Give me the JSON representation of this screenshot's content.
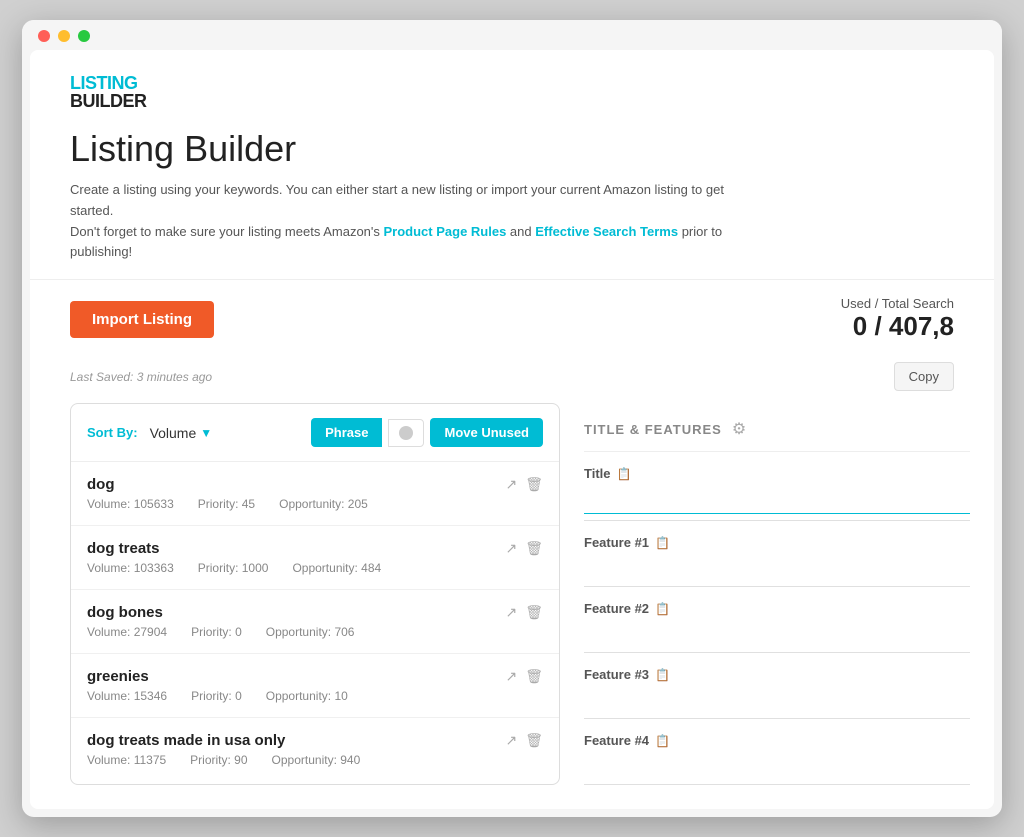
{
  "window": {
    "chrome_dots": [
      "red",
      "yellow",
      "green"
    ]
  },
  "logo": {
    "listing": "LISTING",
    "builder": "BUILDER"
  },
  "page": {
    "title": "Listing Builder",
    "description_1": "Create a listing using your keywords. You can either start a new listing or import your current Amazon listing to get started.",
    "description_2": "Don't forget to make sure your listing meets Amazon's ",
    "link_1": "Product Page Rules",
    "description_3": " and ",
    "link_2": "Effective Search Terms",
    "description_4": " prior to publishing!"
  },
  "toolbar": {
    "import_label": "Import Listing",
    "used_label": "Used / Total Search",
    "used_value": "0 / 407,8"
  },
  "last_saved": {
    "text": "Last Saved: 3 minutes ago",
    "copy_label": "Copy"
  },
  "keywords_panel": {
    "sort_label": "Sort By:",
    "sort_value": "Volume",
    "phrase_label": "Phrase",
    "move_unused_label": "Move Unused",
    "items": [
      {
        "name": "dog",
        "volume": "Volume: 105633",
        "priority": "Priority: 45",
        "opportunity": "Opportunity: 205"
      },
      {
        "name": "dog treats",
        "volume": "Volume: 103363",
        "priority": "Priority: 1000",
        "opportunity": "Opportunity: 484"
      },
      {
        "name": "dog bones",
        "volume": "Volume: 27904",
        "priority": "Priority: 0",
        "opportunity": "Opportunity: 706"
      },
      {
        "name": "greenies",
        "volume": "Volume: 15346",
        "priority": "Priority: 0",
        "opportunity": "Opportunity: 10"
      },
      {
        "name": "dog treats made in usa only",
        "volume": "Volume: 11375",
        "priority": "Priority: 90",
        "opportunity": "Opportunity: 940"
      }
    ]
  },
  "features_panel": {
    "title": "TITLE & FEATURES",
    "fields": [
      {
        "label": "Title",
        "placeholder": ""
      },
      {
        "label": "Feature #1",
        "placeholder": ""
      },
      {
        "label": "Feature #2",
        "placeholder": ""
      },
      {
        "label": "Feature #3",
        "placeholder": ""
      },
      {
        "label": "Feature #4",
        "placeholder": ""
      }
    ]
  }
}
